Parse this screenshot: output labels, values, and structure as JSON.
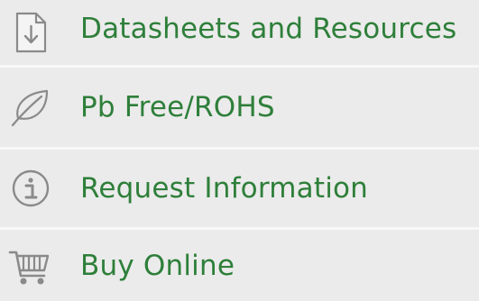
{
  "menu": {
    "items": [
      {
        "label": "Datasheets and Resources",
        "icon": "document-download-icon"
      },
      {
        "label": "Pb Free/ROHS",
        "icon": "leaf-icon"
      },
      {
        "label": "Request Information",
        "icon": "info-icon"
      },
      {
        "label": "Buy Online",
        "icon": "shopping-cart-icon"
      }
    ]
  },
  "colors": {
    "label": "#2e7f3a",
    "icon": "#8a8a8a",
    "background": "#ebebeb",
    "divider": "#f8f8f8"
  }
}
